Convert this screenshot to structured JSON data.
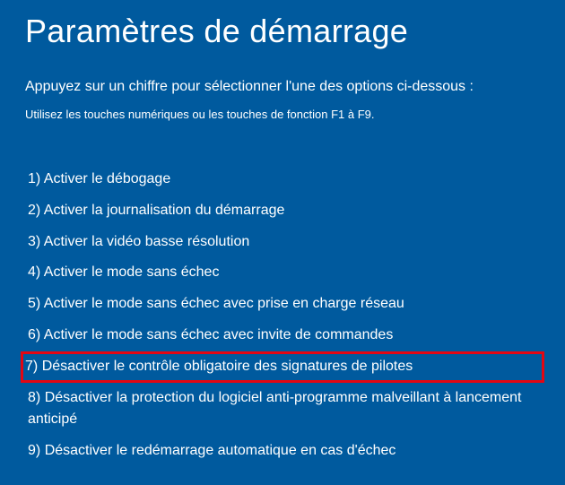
{
  "title": "Paramètres de démarrage",
  "subtitle": "Appuyez sur un chiffre pour sélectionner l'une des options ci-dessous :",
  "hint": "Utilisez les touches numériques ou les touches de fonction F1 à F9.",
  "options": [
    {
      "num": "1)",
      "label": "Activer le débogage"
    },
    {
      "num": "2)",
      "label": "Activer la journalisation du démarrage"
    },
    {
      "num": "3)",
      "label": "Activer la vidéo basse résolution"
    },
    {
      "num": "4)",
      "label": "Activer le mode sans échec"
    },
    {
      "num": "5)",
      "label": "Activer le mode sans échec avec prise en charge réseau"
    },
    {
      "num": "6)",
      "label": "Activer le mode sans échec avec invite de commandes"
    },
    {
      "num": "7)",
      "label": "Désactiver le contrôle obligatoire des signatures de pilotes"
    },
    {
      "num": "8)",
      "label": "Désactiver la protection du logiciel anti-programme malveillant à lancement anticipé"
    },
    {
      "num": "9)",
      "label": "Désactiver le redémarrage automatique en cas d'échec"
    }
  ],
  "highlighted_index": 6
}
